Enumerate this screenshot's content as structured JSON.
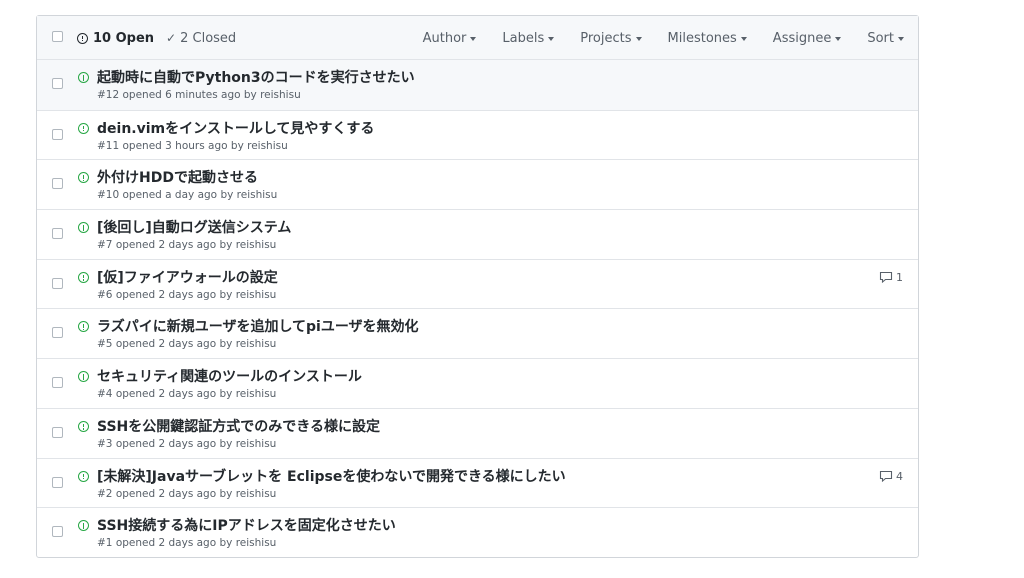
{
  "header": {
    "open_label": "10 Open",
    "closed_label": "2 Closed",
    "filters": [
      "Author",
      "Labels",
      "Projects",
      "Milestones",
      "Assignee",
      "Sort"
    ]
  },
  "issues": [
    {
      "title": "起動時に自動でPython3のコードを実行させたい",
      "meta": "#12 opened 6 minutes ago by reishisu",
      "comments": ""
    },
    {
      "title": "dein.vimをインストールして見やすくする",
      "meta": "#11 opened 3 hours ago by reishisu",
      "comments": ""
    },
    {
      "title": "外付けHDDで起動させる",
      "meta": "#10 opened a day ago by reishisu",
      "comments": ""
    },
    {
      "title": "[後回し]自動ログ送信システム",
      "meta": "#7 opened 2 days ago by reishisu",
      "comments": ""
    },
    {
      "title": "[仮]ファイアウォールの設定",
      "meta": "#6 opened 2 days ago by reishisu",
      "comments": "1"
    },
    {
      "title": "ラズパイに新規ユーザを追加してpiユーザを無効化",
      "meta": "#5 opened 2 days ago by reishisu",
      "comments": ""
    },
    {
      "title": "セキュリティ関連のツールのインストール",
      "meta": "#4 opened 2 days ago by reishisu",
      "comments": ""
    },
    {
      "title": "SSHを公開鍵認証方式でのみできる様に設定",
      "meta": "#3 opened 2 days ago by reishisu",
      "comments": ""
    },
    {
      "title": "[未解決]Javaサーブレットを Eclipseを使わないで開発できる様にしたい",
      "meta": "#2 opened 2 days ago by reishisu",
      "comments": "4"
    },
    {
      "title": "SSH接続する為にIPアドレスを固定化させたい",
      "meta": "#1 opened 2 days ago by reishisu",
      "comments": ""
    }
  ],
  "colors": {
    "open_icon": "#28a745",
    "text": "#24292e",
    "muted": "#586069",
    "border": "#e1e4e8",
    "header_bg": "#f6f8fa"
  }
}
